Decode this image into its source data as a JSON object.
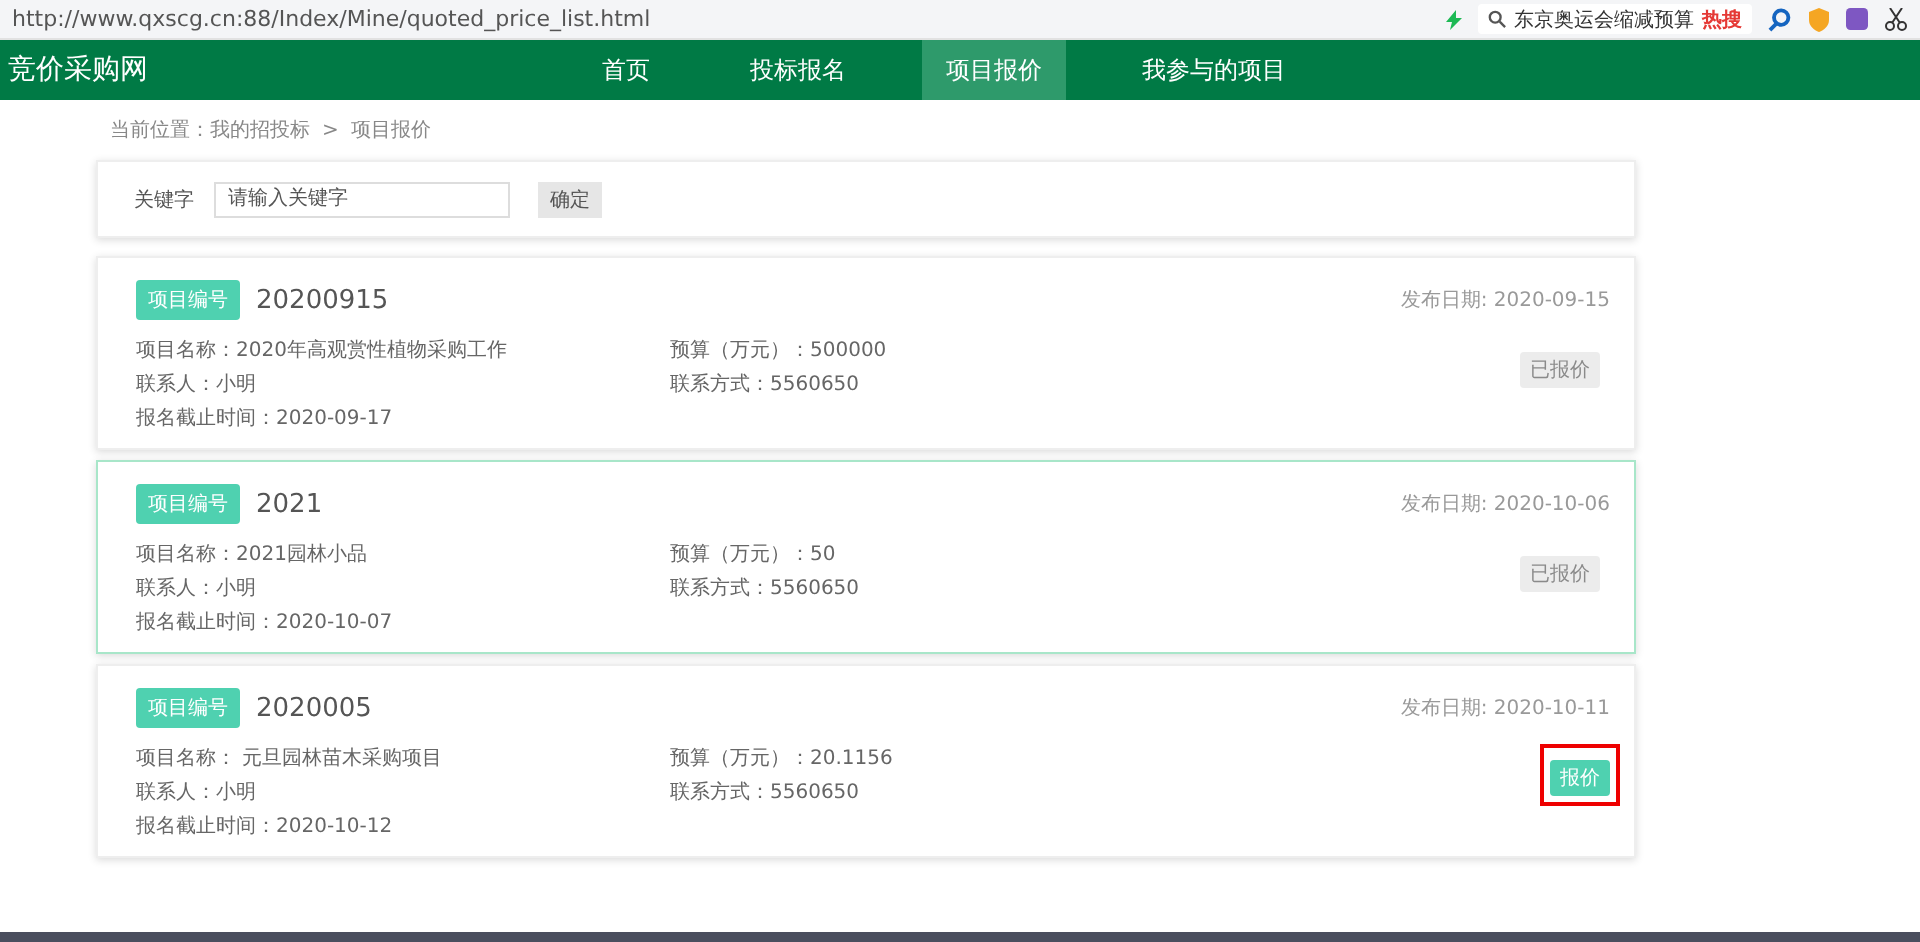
{
  "browser": {
    "url": "http://www.qxscg.cn:88/Index/Mine/quoted_price_list.html",
    "search_text": "东京奥运会缩减预算",
    "search_badge": "热搜"
  },
  "site": {
    "logo": "竞价采购网",
    "nav": [
      {
        "label": "首页",
        "selected": false
      },
      {
        "label": "投标报名",
        "selected": false
      },
      {
        "label": "项目报价",
        "selected": true
      },
      {
        "label": "我参与的项目",
        "selected": false
      }
    ]
  },
  "breadcrumb": {
    "items": [
      "当前位置：我的招投标",
      "项目报价"
    ],
    "separator": ">"
  },
  "search": {
    "label": "关键字",
    "placeholder": "请输入关键字",
    "button": "确定"
  },
  "projects": [
    {
      "tag": "项目编号",
      "number": "20200915",
      "date": "发布日期: 2020-09-15",
      "name": "项目名称：2020年高观赏性植物采购工作",
      "contact": "联系人：小明",
      "deadline": "报名截止时间：2020-09-17",
      "budget": "预算（万元）：500000",
      "phone": "联系方式：5560650",
      "button": "已报价",
      "disabled": true,
      "hovered": false,
      "highlighted": false
    },
    {
      "tag": "项目编号",
      "number": "2021",
      "date": "发布日期: 2020-10-06",
      "name": "项目名称：2021园林小品",
      "contact": "联系人：小明",
      "deadline": "报名截止时间：2020-10-07",
      "budget": "预算（万元）：50",
      "phone": "联系方式：5560650",
      "button": "已报价",
      "disabled": true,
      "hovered": true,
      "highlighted": false
    },
    {
      "tag": "项目编号",
      "number": "2020005",
      "date": "发布日期: 2020-10-11",
      "name": "项目名称： 元旦园林苗木采购项目",
      "contact": "联系人：小明",
      "deadline": "报名截止时间：2020-10-12",
      "budget": "预算（万元）：20.1156",
      "phone": "联系方式：5560650",
      "button": "报价",
      "disabled": false,
      "hovered": false,
      "highlighted": true
    }
  ]
}
